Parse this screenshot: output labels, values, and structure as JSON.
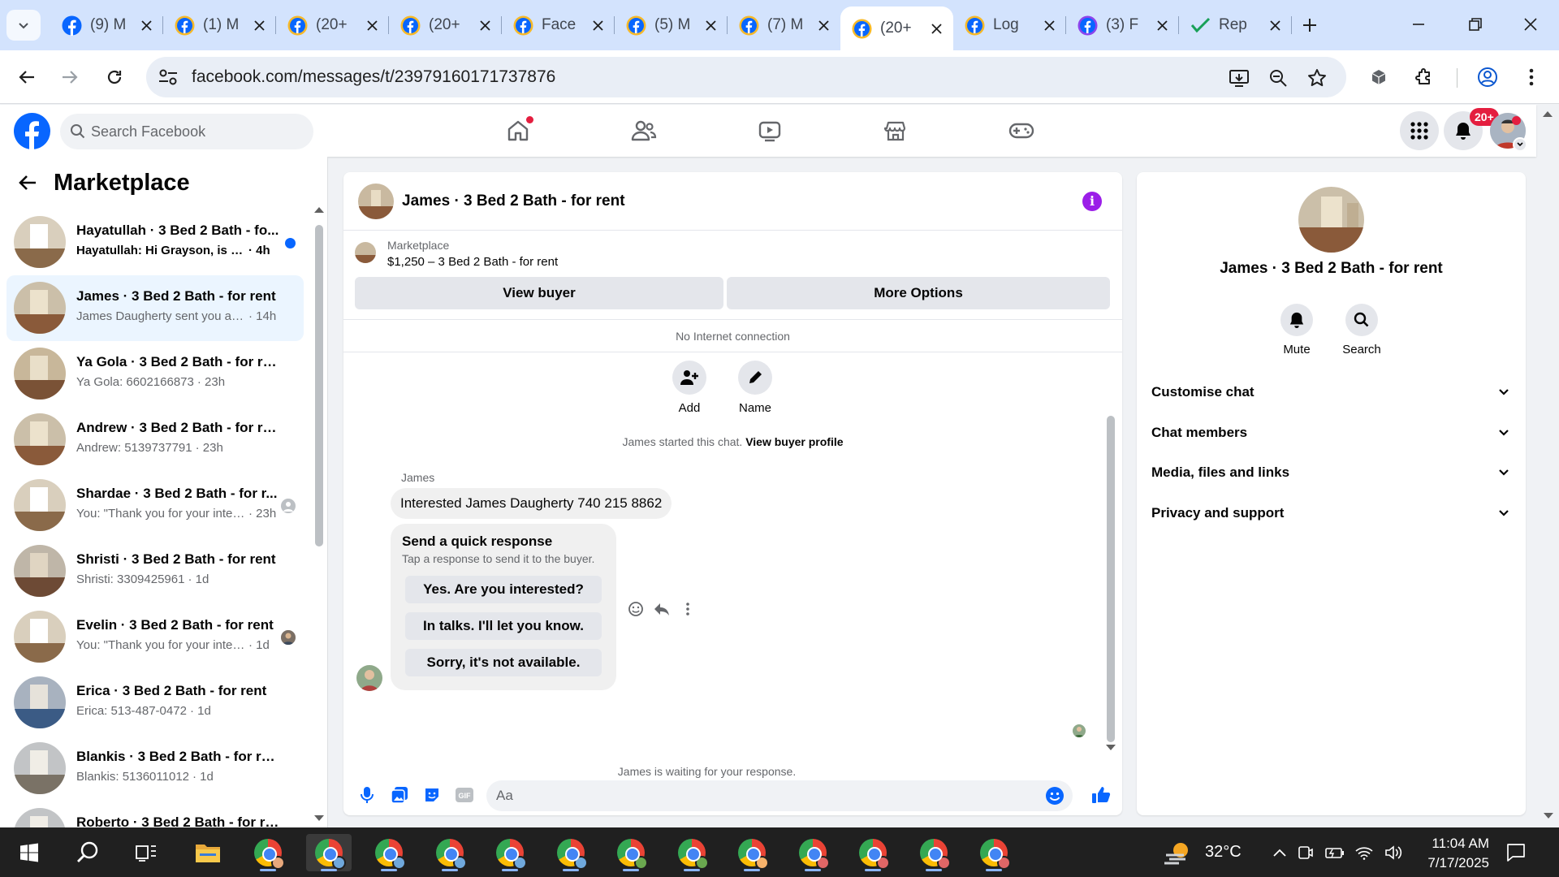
{
  "browser": {
    "tabs": [
      {
        "title": "(9) M",
        "favicon": "facebook-icon",
        "active": false
      },
      {
        "title": "(1) M",
        "favicon": "facebook-messenger-icon",
        "active": false
      },
      {
        "title": "(20+",
        "favicon": "facebook-messenger-icon",
        "active": false
      },
      {
        "title": "(20+",
        "favicon": "facebook-messenger-icon",
        "active": false
      },
      {
        "title": "Face",
        "favicon": "facebook-messenger-icon",
        "active": false
      },
      {
        "title": "(5) M",
        "favicon": "facebook-messenger-icon",
        "active": false
      },
      {
        "title": "(7) M",
        "favicon": "facebook-messenger-icon",
        "active": false
      },
      {
        "title": "(20+",
        "favicon": "facebook-messenger-icon",
        "active": true
      },
      {
        "title": "Log",
        "favicon": "facebook-messenger-icon",
        "active": false
      },
      {
        "title": "(3) F",
        "favicon": "facebook-messenger-purple-icon",
        "active": false
      },
      {
        "title": "Rep",
        "favicon": "green-check-icon",
        "active": false
      }
    ],
    "url": "facebook.com/messages/t/23979160171737876"
  },
  "facebook": {
    "search_placeholder": "Search Facebook",
    "notification_badge": "20+",
    "brand_color": "#0866ff"
  },
  "sidebar": {
    "title": "Marketplace",
    "chats": [
      {
        "name": "Hayatullah · 3 Bed 2 Bath - fo...",
        "preview": "Hayatullah: Hi Grayson, is this s...",
        "time": "4h",
        "unread": true,
        "active": false,
        "status": "unread-dot"
      },
      {
        "name": "James · 3 Bed 2 Bath - for rent",
        "preview": "James Daugherty sent you a mes...",
        "time": "14h",
        "unread": false,
        "active": true,
        "status": ""
      },
      {
        "name": "Ya Gola · 3 Bed 2 Bath - for rent",
        "preview": "Ya Gola: 6602166873",
        "time": "23h",
        "unread": false,
        "active": false,
        "status": ""
      },
      {
        "name": "Andrew · 3 Bed 2 Bath - for rent",
        "preview": "Andrew: 5139737791",
        "time": "23h",
        "unread": false,
        "active": false,
        "status": ""
      },
      {
        "name": "Shardae · 3 Bed 2 Bath - for r...",
        "preview": "You: \"Thank you for your inter...",
        "time": "23h",
        "unread": false,
        "active": false,
        "status": "seen-default"
      },
      {
        "name": "Shristi · 3 Bed 2 Bath - for rent",
        "preview": "Shristi: 3309425961",
        "time": "1d",
        "unread": false,
        "active": false,
        "status": ""
      },
      {
        "name": "Evelin · 3 Bed 2 Bath - for rent",
        "preview": "You: \"Thank you for your intere...",
        "time": "1d",
        "unread": false,
        "active": false,
        "status": "seen-photo"
      },
      {
        "name": "Erica · 3 Bed 2 Bath - for rent",
        "preview": "Erica: 513-487-0472",
        "time": "1d",
        "unread": false,
        "active": false,
        "status": ""
      },
      {
        "name": "Blankis · 3 Bed 2 Bath - for rent",
        "preview": "Blankis: 5136011012",
        "time": "1d",
        "unread": false,
        "active": false,
        "status": ""
      },
      {
        "name": "Roberto · 3 Bed 2 Bath - for rent",
        "preview": "",
        "time": "",
        "unread": false,
        "active": false,
        "status": ""
      }
    ]
  },
  "conversation": {
    "title": "James · 3 Bed 2 Bath - for rent",
    "marketplace_label": "Marketplace",
    "listing": "$1,250 – 3 Bed 2 Bath - for rent",
    "view_buyer_label": "View buyer",
    "more_options_label": "More Options",
    "connection_status": "No Internet connection",
    "add_label": "Add",
    "name_label": "Name",
    "started_text": "James started this chat.",
    "view_profile_link": "View buyer profile",
    "sender_name": "James",
    "message": "Interested James Daugherty 740 215 8862",
    "quick_response": {
      "heading": "Send a quick response",
      "subtext": "Tap a response to send it to the buyer.",
      "options": [
        "Yes. Are you interested?",
        "In talks. I'll let you know.",
        "Sorry, it's not available."
      ]
    },
    "waiting_text": "James is waiting for your response.",
    "composer_placeholder": "Aa"
  },
  "info_panel": {
    "title": "James · 3 Bed 2 Bath - for rent",
    "mute_label": "Mute",
    "search_label": "Search",
    "sections": [
      "Customise chat",
      "Chat members",
      "Media, files and links",
      "Privacy and support"
    ]
  },
  "taskbar": {
    "weather": "32°C",
    "time": "11:04 AM",
    "date": "7/17/2025",
    "chrome_profile_colors": [
      "#e8a87c",
      "#6fa8dc",
      "#6fa8dc",
      "#6fa8dc",
      "#6fa8dc",
      "#6fa8dc",
      "#6aa84f",
      "#6aa84f",
      "#f6b26b",
      "#e06666",
      "#e06666",
      "#e06666",
      "#e06666"
    ]
  }
}
